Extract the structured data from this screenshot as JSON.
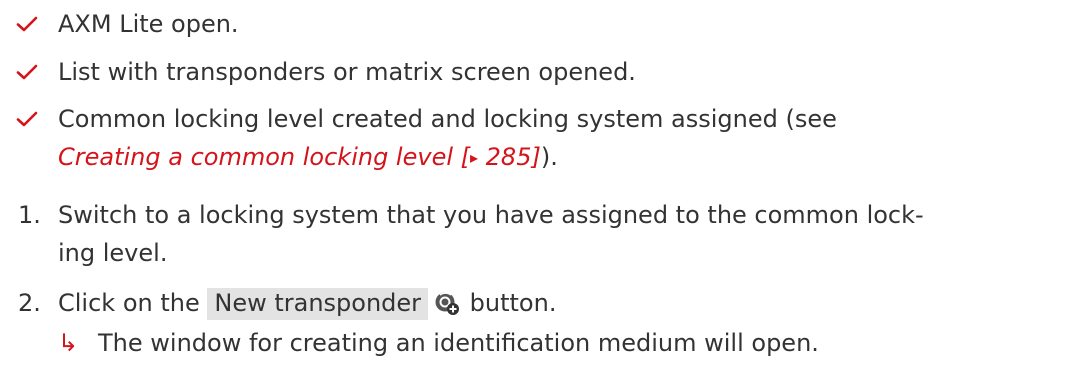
{
  "colors": {
    "text": "#333333",
    "accent": "#d4141a",
    "button_bg": "#e3e3e3"
  },
  "prerequisites": [
    {
      "icon": "checkmark-icon",
      "text": "AXM Lite open."
    },
    {
      "icon": "checkmark-icon",
      "text": "List with transponders or matrix screen opened."
    },
    {
      "icon": "checkmark-icon",
      "text_line1": "Common locking level created and locking system assigned (see",
      "link_text": "Creating a common locking level [",
      "link_arrow": "▸",
      "link_page": " 285]",
      "text_after_link": ")."
    }
  ],
  "steps": [
    {
      "number": "1.",
      "line1": "Switch to a locking system that you have assigned to the common lock-",
      "line2": "ing level."
    },
    {
      "number": "2.",
      "text_before": "Click on the ",
      "button_label": "New transponder",
      "button_icon": "new-transponder-icon",
      "text_after": " button.",
      "result_arrow": "↳",
      "result": "The window for creating an identification medium will open."
    }
  ]
}
